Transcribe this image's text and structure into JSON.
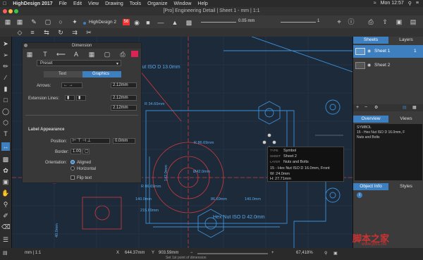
{
  "menubar": {
    "app": "HighDesign 2017",
    "items": [
      "File",
      "Edit",
      "View",
      "Drawing",
      "Tools",
      "Organize",
      "Window",
      "Help"
    ],
    "clock": "Mon 12:57"
  },
  "window": {
    "title": "[Pro] Engineering Detail | Sheet 1 - mm | 1:1"
  },
  "toolbar": {
    "doc_name": "HighDesign 2",
    "layer_count": "56",
    "line_weight": "0.05 mm",
    "value_1": "1"
  },
  "dimension_panel": {
    "title": "Dimension",
    "preset_label": "Preset",
    "tabs": [
      "Text",
      "Graphics"
    ],
    "arrows_label": "Arrows:",
    "arrows_value": "2.12mm",
    "extension_label": "Extension Lines:",
    "extension_values": [
      "2.12mm",
      "2.12mm"
    ],
    "label_appearance": "Label Appearance",
    "position_label": "Position:",
    "position_value": "0.0mm",
    "border_label": "Border:",
    "border_value": "1.00",
    "orientation_label": "Orientation:",
    "orientation_aligned": "Aligned",
    "orientation_horizontal": "Horizontal",
    "flip_text": "Flip text"
  },
  "canvas": {
    "labels": {
      "hex_top": "Hex Nut ISO D 13.0mm",
      "r34": "R 34.60mm",
      "r86_1": "R 86.69mm",
      "r86_2": "R 86.69mm",
      "r86_3": "86.69mm",
      "d42": "Ø42.0mm",
      "v142": "142.0mm",
      "h140": "140.0mm",
      "h140b": "140.0mm",
      "h215": "215.69mm",
      "hex_bottom": "Hex Nut ISO D 42.0mm",
      "v40": "40.0mm"
    }
  },
  "tooltip": {
    "type_label": "TYPE",
    "type_value": "Symbol",
    "sheet_label": "SHEET",
    "sheet_value": "Sheet 2",
    "layer_label": "LAYER",
    "layer_value": "Nuts and Bolts",
    "line1": "15 - Hex Nut ISO D 16.0mm, Front",
    "line2": "W: 24.0mm",
    "line3": "H: 27.71mm"
  },
  "right_panel": {
    "tabs": [
      "Sheets",
      "Layers"
    ],
    "sheets": [
      "Sheet 1",
      "Sheet 2"
    ],
    "view_tabs": [
      "Overview",
      "Views"
    ],
    "overview_lines": [
      "SYMBOL",
      "15 - Hex Nut ISO D 16.0mm, F",
      "Nuts and Bolts"
    ],
    "info_tabs": [
      "Object Info",
      "Styles"
    ]
  },
  "statusbar": {
    "scale": "mm | 1:1",
    "x_label": "X",
    "x_value": "644.37mm",
    "y_label": "Y",
    "y_value": "903.59mm",
    "zoom": "67,418%",
    "hint": "Set 1st point of dimension",
    "watermark": "脚本之家",
    "watermark_url": "www.jb51.net"
  },
  "colors": {
    "accent": "#3d7fbf",
    "drawing_blue": "#3c8fd6",
    "drawing_red": "#d23a3a"
  }
}
